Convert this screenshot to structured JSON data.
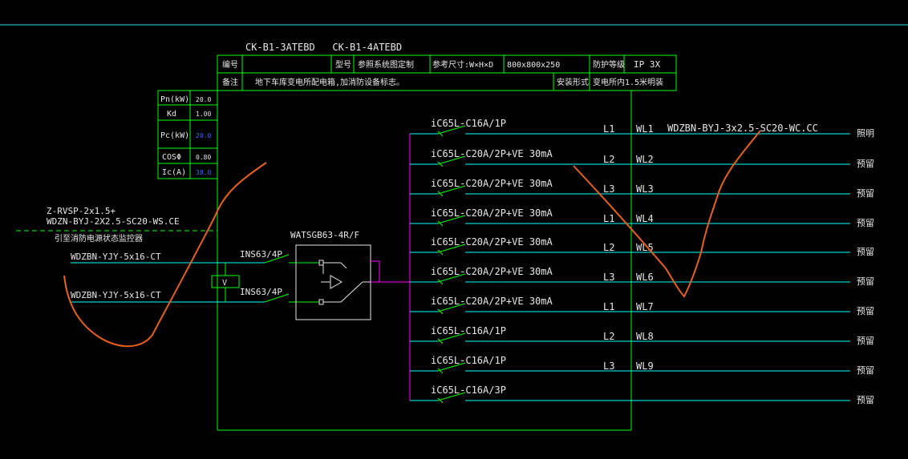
{
  "panel_ids": "CK-B1-3ATEBD   CK-B1-4ATEBD",
  "header_row1": {
    "bh_label": "编号",
    "model_label": "型号",
    "model_value": "参照系统图定制",
    "dims_label": "参考尺寸:W×H×D",
    "dims_value": "800x800x250",
    "protect_label": "防护等级",
    "protect_value": "IP 3X"
  },
  "header_row2": {
    "note_label": "备注",
    "note_value": "地下车库变电所配电箱,加消防设备标志。",
    "install_label": "安装形式",
    "install_value": "变电所内1.5米明装"
  },
  "params": [
    {
      "label": "Pn(kW)",
      "value": "20.0"
    },
    {
      "label": "Kd",
      "value": "1.00"
    },
    {
      "label": "Pc(kW)",
      "value": "20.0"
    },
    {
      "label": "COSΦ",
      "value": "0.80"
    },
    {
      "label": "Ic(A)",
      "value": "38.0"
    }
  ],
  "incoming": {
    "monitor_cable_1": "Z-RVSP-2x1.5+",
    "monitor_cable_2": "WDZN-BYJ-2X2.5-SC20-WS.CE",
    "monitor_note": "引至消防电源状态监控器",
    "feeder_1": "WDZBN-YJY-5x16-CT",
    "feeder_2": "WDZBN-YJY-5x16-CT",
    "voltage_symbol": "V",
    "switch_1": "INS63/4P",
    "switch_2": "INS63/4P",
    "ats_label": "WATSGB63-4R/F"
  },
  "circuits": [
    {
      "breaker": "iC65L-C16A/1P",
      "phase": "L1",
      "loop": "WL1",
      "cable": "WDZBN-BYJ-3x2.5-SC20-WC.CC",
      "use": "照明"
    },
    {
      "breaker": "iC65L-C20A/2P+VE 30mA",
      "phase": "L2",
      "loop": "WL2",
      "cable": "",
      "use": "预留"
    },
    {
      "breaker": "iC65L-C20A/2P+VE 30mA",
      "phase": "L3",
      "loop": "WL3",
      "cable": "",
      "use": "预留"
    },
    {
      "breaker": "iC65L-C20A/2P+VE 30mA",
      "phase": "L1",
      "loop": "WL4",
      "cable": "",
      "use": "预留"
    },
    {
      "breaker": "iC65L-C20A/2P+VE 30mA",
      "phase": "L2",
      "loop": "WL5",
      "cable": "",
      "use": "预留"
    },
    {
      "breaker": "iC65L-C20A/2P+VE 30mA",
      "phase": "L3",
      "loop": "WL6",
      "cable": "",
      "use": "预留"
    },
    {
      "breaker": "iC65L-C20A/2P+VE 30mA",
      "phase": "L1",
      "loop": "WL7",
      "cable": "",
      "use": "预留"
    },
    {
      "breaker": "iC65L-C16A/1P",
      "phase": "L2",
      "loop": "WL8",
      "cable": "",
      "use": "预留"
    },
    {
      "breaker": "iC65L-C16A/1P",
      "phase": "L3",
      "loop": "WL9",
      "cable": "",
      "use": "预留"
    },
    {
      "breaker": "iC65L-C16A/3P",
      "phase": "",
      "loop": "",
      "cable": "",
      "use": "预留"
    }
  ],
  "colors": {
    "green": "#00ff00",
    "cyan": "#00ffff",
    "magenta": "#ff00ff",
    "white": "#e8e8e8",
    "blue": "#3a6bff",
    "annotation": "#e8601c"
  }
}
